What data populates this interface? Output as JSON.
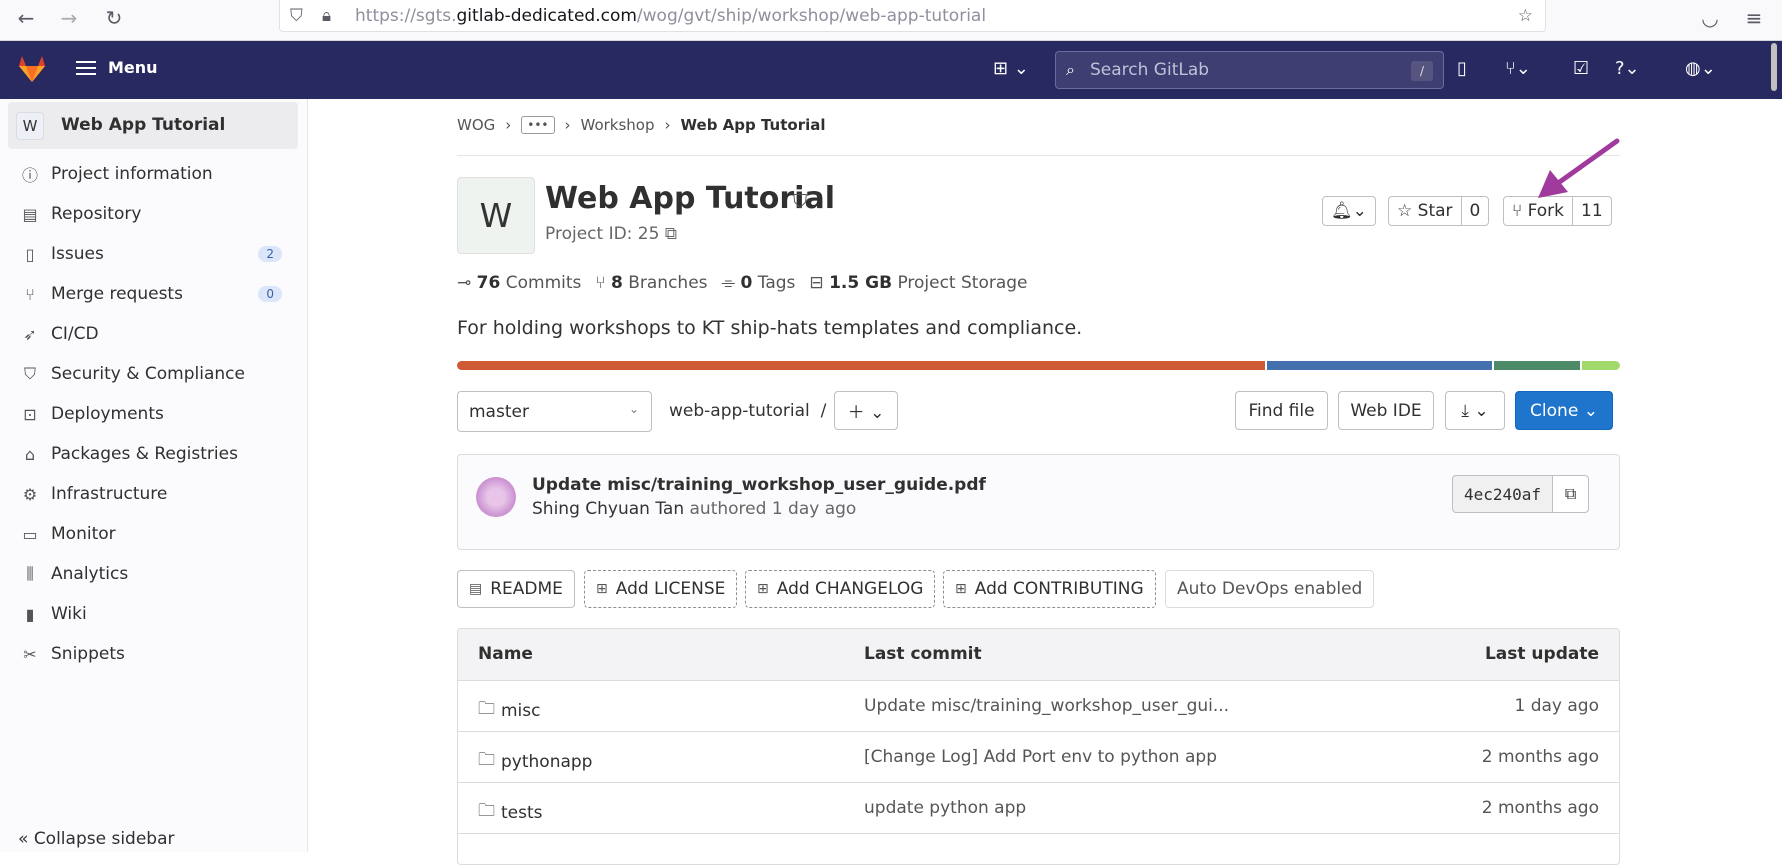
{
  "browser": {
    "url_prefix": "https://sgts.",
    "url_domain": "gitlab-dedicated.com",
    "url_path": "/wog/gvt/ship/workshop/web-app-tutorial"
  },
  "header": {
    "menu_label": "Menu",
    "search_placeholder": "Search GitLab",
    "search_shortcut": "/",
    "nav_color": "#292961"
  },
  "sidebar": {
    "project_avatar": "W",
    "project_name": "Web App Tutorial",
    "items": [
      {
        "label": "Project information",
        "icon": "info-icon"
      },
      {
        "label": "Repository",
        "icon": "document-icon"
      },
      {
        "label": "Issues",
        "icon": "issues-icon",
        "count": "2"
      },
      {
        "label": "Merge requests",
        "icon": "merge-request-icon",
        "count": "0"
      },
      {
        "label": "CI/CD",
        "icon": "rocket-icon"
      },
      {
        "label": "Security & Compliance",
        "icon": "shield-icon"
      },
      {
        "label": "Deployments",
        "icon": "deployments-icon"
      },
      {
        "label": "Packages & Registries",
        "icon": "package-icon"
      },
      {
        "label": "Infrastructure",
        "icon": "cloud-gear-icon"
      },
      {
        "label": "Monitor",
        "icon": "monitor-icon"
      },
      {
        "label": "Analytics",
        "icon": "chart-icon"
      },
      {
        "label": "Wiki",
        "icon": "book-icon"
      },
      {
        "label": "Snippets",
        "icon": "scissors-icon"
      }
    ],
    "collapse_label": "Collapse sidebar"
  },
  "breadcrumb": {
    "root": "WOG",
    "ellipsis": "•••",
    "parent": "Workshop",
    "current": "Web App Tutorial"
  },
  "project": {
    "avatar": "W",
    "title": "Web App Tutorial",
    "id_label": "Project ID: 25",
    "star_label": "Star",
    "star_count": "0",
    "fork_label": "Fork",
    "fork_count": "11",
    "stats": {
      "commits_num": "76",
      "commits_label": "Commits",
      "branches_num": "8",
      "branches_label": "Branches",
      "tags_num": "0",
      "tags_label": "Tags",
      "storage_num": "1.5 GB",
      "storage_label": "Project Storage"
    },
    "description": "For holding workshops to KT ship-hats templates and compliance.",
    "language_colors": [
      "#cf5a36",
      "#4470ad",
      "#4d8a68",
      "#a3d96a"
    ]
  },
  "repo_toolbar": {
    "branch": "master",
    "path": "web-app-tutorial",
    "path_sep": "/",
    "find_file": "Find file",
    "web_ide": "Web IDE",
    "clone": "Clone"
  },
  "last_commit": {
    "title": "Update misc/training_workshop_user_guide.pdf",
    "author": "Shing Chyuan Tan",
    "meta": "authored 1 day ago",
    "sha": "4ec240af"
  },
  "chips": {
    "readme": "README",
    "add_license": "Add LICENSE",
    "add_changelog": "Add CHANGELOG",
    "add_contributing": "Add CONTRIBUTING",
    "auto_devops": "Auto DevOps enabled"
  },
  "files": {
    "headers": {
      "name": "Name",
      "last_commit": "Last commit",
      "last_update": "Last update"
    },
    "rows": [
      {
        "name": "misc",
        "commit": "Update misc/training_workshop_user_gui...",
        "updated": "1 day ago"
      },
      {
        "name": "pythonapp",
        "commit": "[Change Log] Add Port env to python app",
        "updated": "2 months ago"
      },
      {
        "name": "tests",
        "commit": "update python app",
        "updated": "2 months ago"
      }
    ]
  },
  "annotation": {
    "arrow_color": "#a03a9c"
  }
}
